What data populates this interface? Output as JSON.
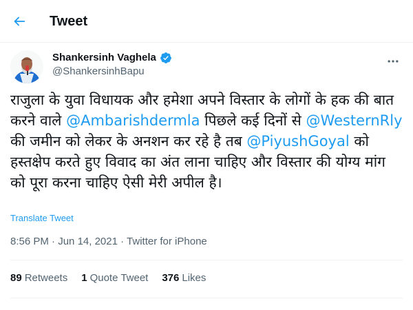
{
  "header": {
    "title": "Tweet",
    "back_icon": "arrow-left-icon"
  },
  "author": {
    "name": "Shankersinh Vaghela",
    "handle": "@ShankersinhBapu",
    "verified_icon": "verified-badge-icon"
  },
  "tweet": {
    "segments": [
      {
        "text": "राजुला के युवा विधायक और हमेशा अपने विस्तार के लोगों के हक की बात करने वाले ",
        "mention": false
      },
      {
        "text": "@Ambarishdermla",
        "mention": true
      },
      {
        "text": " पिछले कई दिनों से ",
        "mention": false
      },
      {
        "text": "@WesternRly",
        "mention": true
      },
      {
        "text": " की जमीन को लेकर के अनशन कर रहे है तब ",
        "mention": false
      },
      {
        "text": "@PiyushGoyal",
        "mention": true
      },
      {
        "text": " को हस्तक्षेप करते हुए विवाद का अंत लाना चाहिए और विस्तार की योग्य मांग को पूरा करना चाहिए ऐसी मेरी अपील है।",
        "mention": false
      }
    ],
    "translate_label": "Translate Tweet",
    "time": "8:56 PM",
    "date": "Jun 14, 2021",
    "source": "Twitter for iPhone"
  },
  "stats": {
    "retweets_count": "89",
    "retweets_label": "Retweets",
    "quotes_count": "1",
    "quotes_label": "Quote Tweet",
    "likes_count": "376",
    "likes_label": "Likes"
  },
  "colors": {
    "accent": "#1d9bf0",
    "text": "#0f1419",
    "secondary": "#536471",
    "divider": "#eff3f4"
  }
}
